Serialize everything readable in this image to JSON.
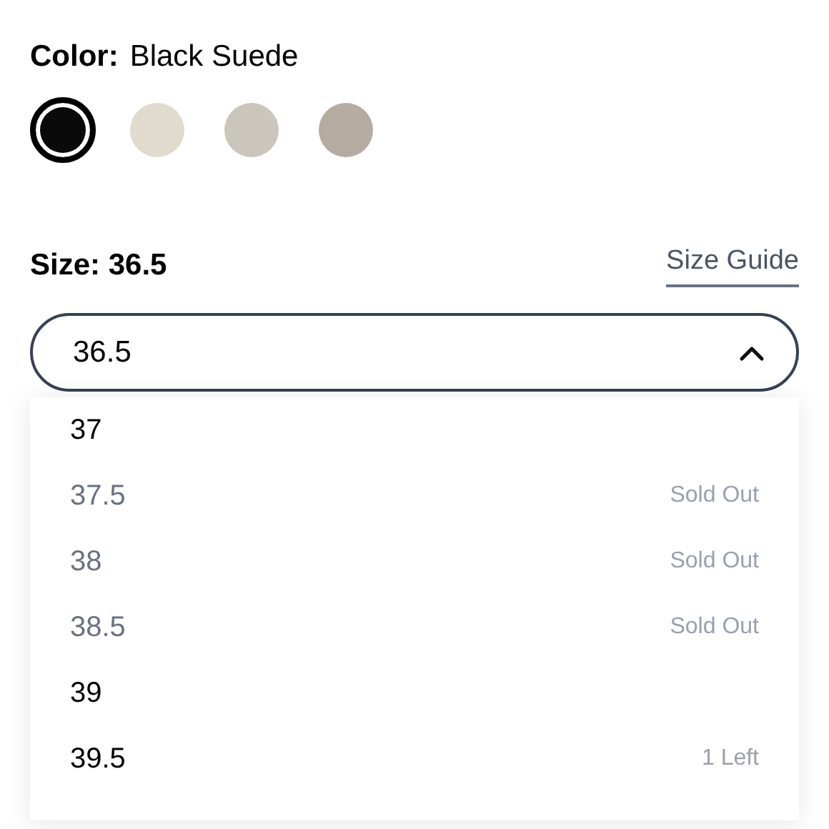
{
  "color_label": "Color:",
  "color_value": "Black Suede",
  "swatches": [
    {
      "color": "#0a0a0a",
      "selected": true
    },
    {
      "color": "#e0dbcd",
      "selected": false
    },
    {
      "color": "#cbc6bb",
      "selected": false
    },
    {
      "color": "#b5aba0",
      "selected": false
    }
  ],
  "size_label": "Size: 36.5",
  "size_guide": "Size Guide",
  "size_select": {
    "value": "36.5",
    "expanded": true
  },
  "options": [
    {
      "size": "37",
      "available": true
    },
    {
      "size": "37.5",
      "available": false,
      "note": "Sold Out"
    },
    {
      "size": "38",
      "available": false,
      "note": "Sold Out"
    },
    {
      "size": "38.5",
      "available": false,
      "note": "Sold Out"
    },
    {
      "size": "39",
      "available": true
    },
    {
      "size": "39.5",
      "available": true,
      "note": "1 Left"
    }
  ]
}
